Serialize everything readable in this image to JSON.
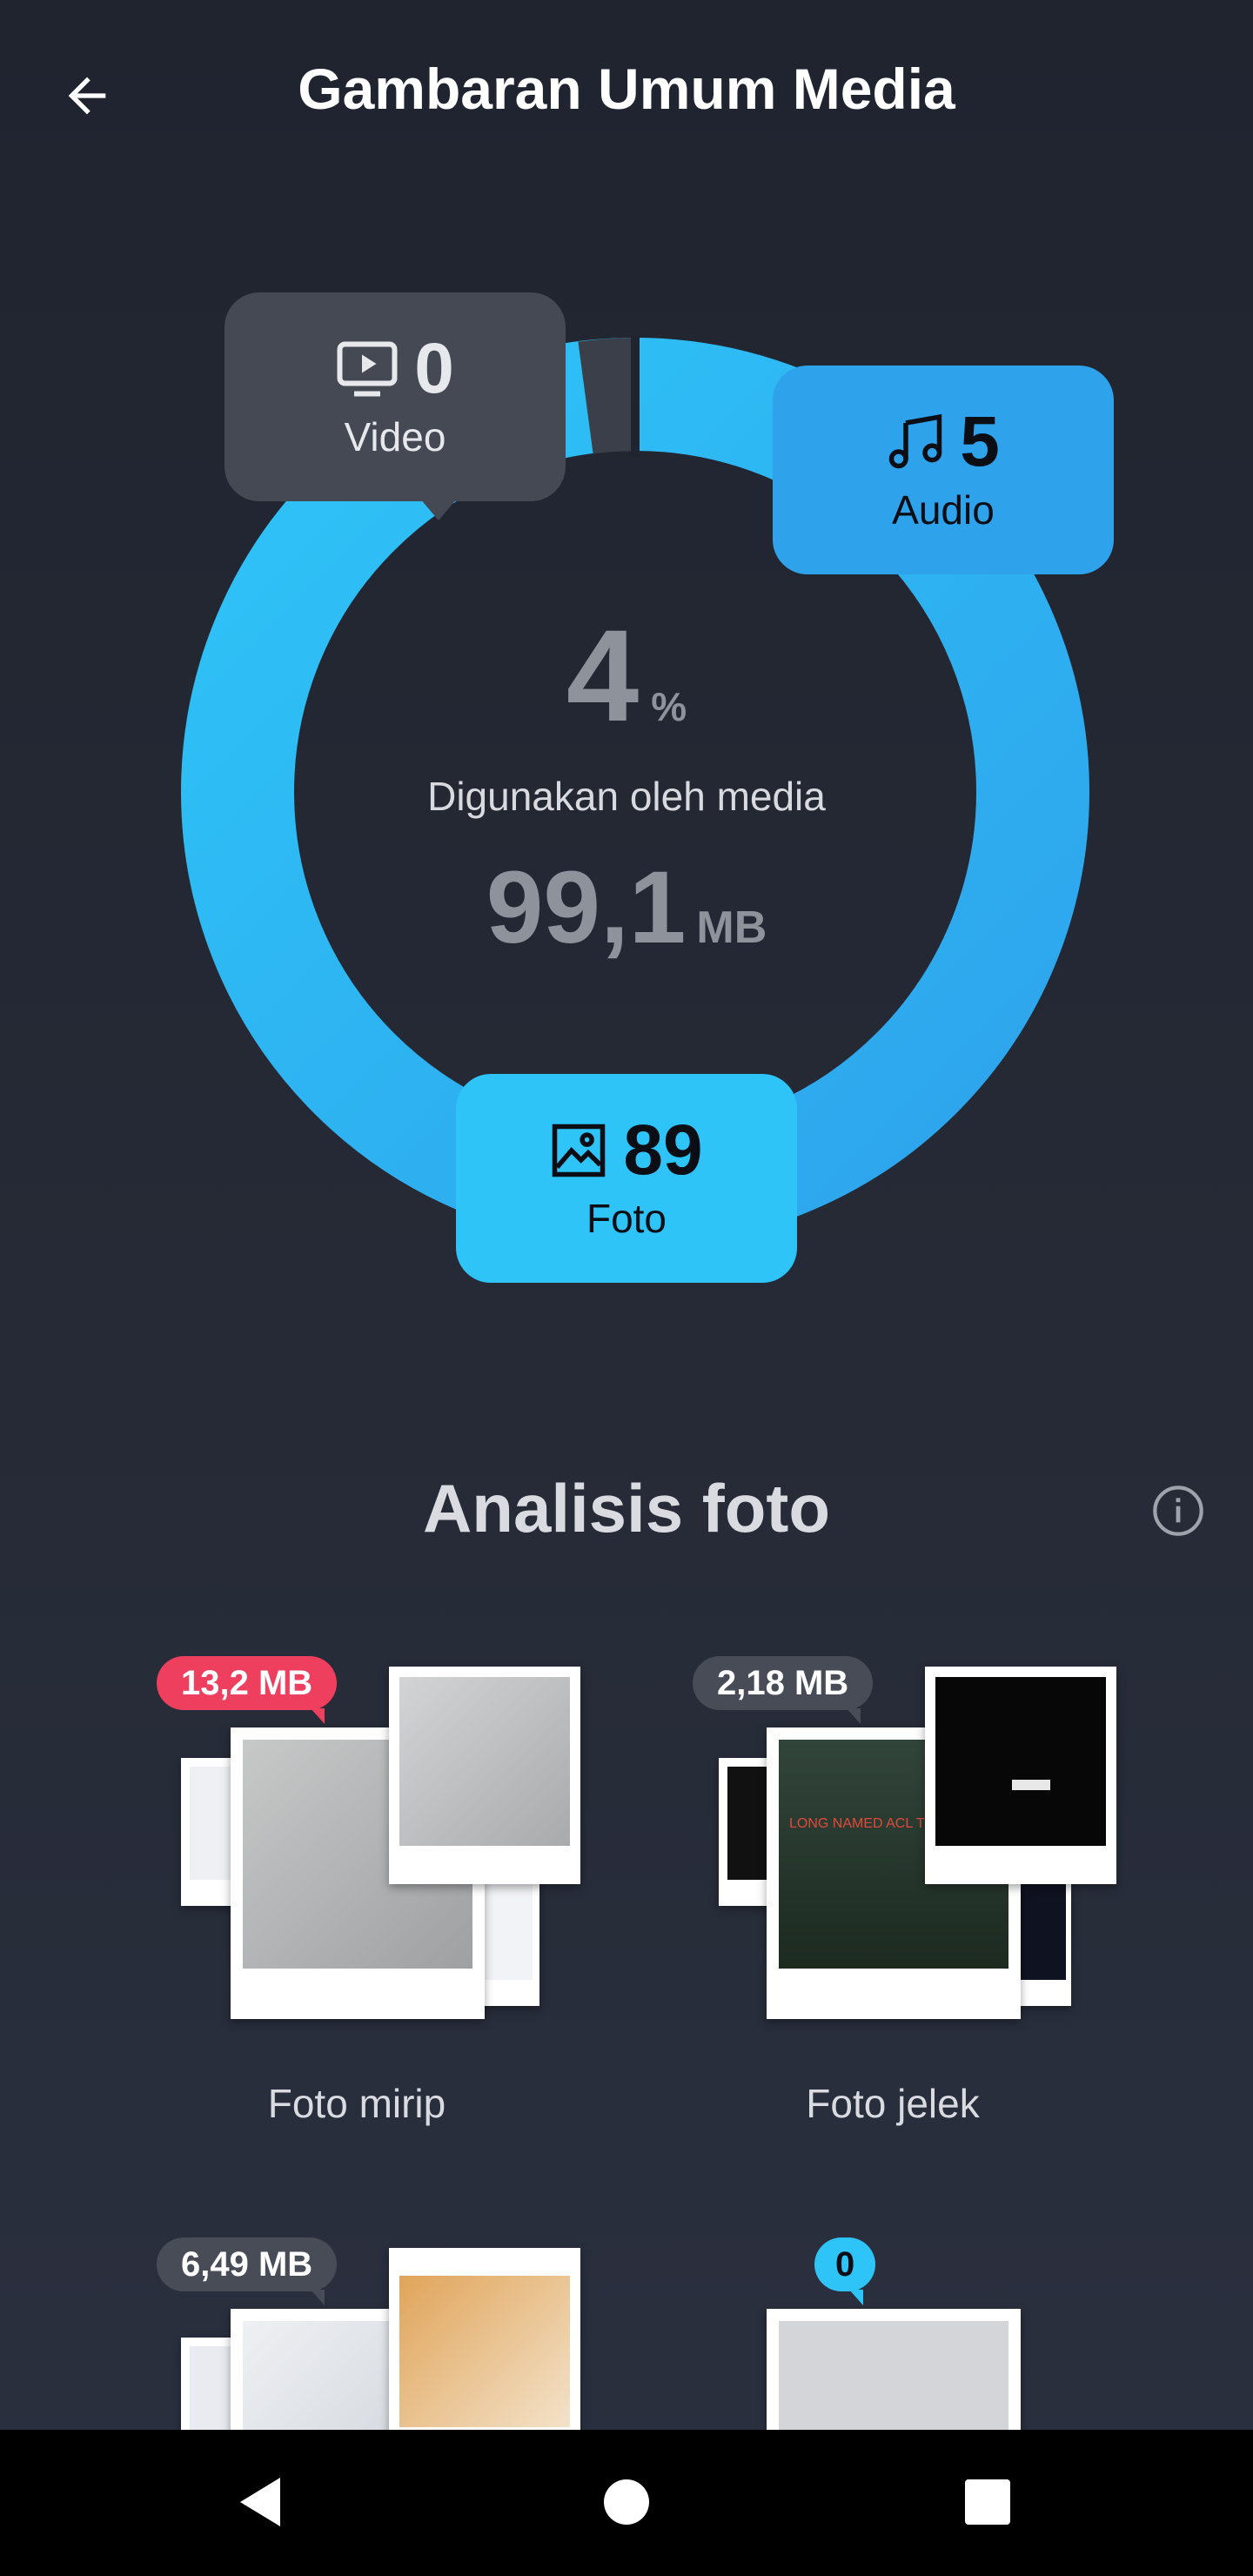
{
  "header": {
    "title": "Gambaran Umum Media",
    "back_icon": "arrow-left-icon"
  },
  "summary": {
    "percent": "4",
    "percent_unit": "%",
    "label": "Digunakan oleh media",
    "size": "99,1",
    "size_unit": "MB"
  },
  "legend": {
    "video": {
      "count": "0",
      "label": "Video",
      "icon": "video-icon",
      "color": "#444954"
    },
    "audio": {
      "count": "5",
      "label": "Audio",
      "icon": "music-note-icon",
      "color": "#2ea3ec"
    },
    "foto": {
      "count": "89",
      "label": "Foto",
      "icon": "image-icon",
      "color": "#2ec4f7"
    }
  },
  "analysis": {
    "title": "Analisis foto",
    "cards": [
      {
        "label": "Foto mirip",
        "size": "13,2 MB",
        "badge_color": "#ef3f5f"
      },
      {
        "label": "Foto jelek",
        "size": "2,18 MB",
        "badge_color": "#474c57",
        "photo_caption": "LONG NAMED ACL TEST"
      },
      {
        "label": "",
        "size": "6,49 MB",
        "badge_color": "#474c57"
      },
      {
        "label": "",
        "size": "0",
        "badge_color": "#2ec4f7"
      }
    ]
  },
  "nav": {
    "back": "nav-back-icon",
    "home": "nav-home-icon",
    "recents": "nav-recents-icon"
  }
}
